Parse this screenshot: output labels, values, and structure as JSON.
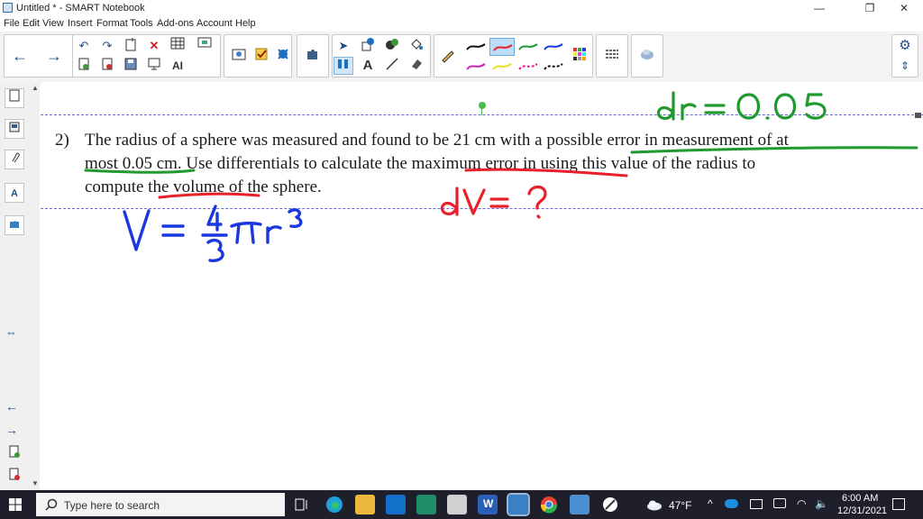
{
  "window": {
    "title": "Untitled * - SMART Notebook",
    "minimize_glyph": "—",
    "maximize_glyph": "❐",
    "close_glyph": "✕"
  },
  "menu": [
    "File",
    "Edit",
    "View",
    "Insert",
    "Format",
    "Tools",
    "Add-ons",
    "Account",
    "Help"
  ],
  "toolbar": {
    "back_glyph": "←",
    "forward_glyph": "→",
    "select_glyph": "➤",
    "text_glyph": "A",
    "ai_glyph": "AI"
  },
  "sidebar": {
    "resize_glyph": "⇔",
    "prev_glyph": "←",
    "next_glyph": "→",
    "tab_text_glyph": "A"
  },
  "problem": {
    "number": "2)",
    "line1": "The radius of a sphere was measured and found to be 21 cm with a possible error in measurement of at",
    "line2": "most 0.05 cm. Use differentials to calculate the maximum error in using this value of the radius to",
    "line3": "compute the volume of the sphere."
  },
  "handwriting": {
    "dr": "dr = 0.05",
    "dv": "dV = ?",
    "volume_formula": "V = 4/3 πr³"
  },
  "colors": {
    "ink_green": "#1f9a2f",
    "ink_red": "#e8202a",
    "ink_blue": "#1a37e0",
    "taskbar_bg": "#1f1f2b",
    "page_guide": "#6a6ad6"
  },
  "taskbar": {
    "search_placeholder": "Type here to search",
    "weather": "47°F",
    "time": "6:00 AM",
    "date": "12/31/2021"
  }
}
